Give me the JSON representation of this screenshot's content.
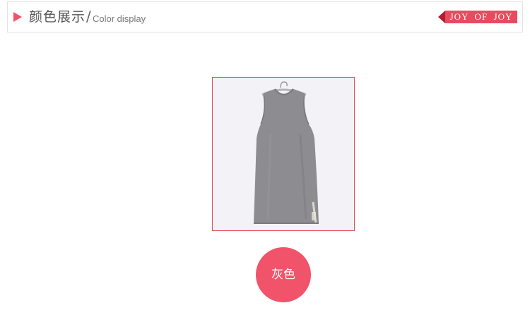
{
  "header": {
    "title_cn": "颜色展示",
    "separator": "/",
    "title_en": "Color display",
    "brand": "JOY  OF  JOY"
  },
  "product": {
    "image_icon": "sleeveless-gray-dress-image"
  },
  "swatch": {
    "label": "灰色"
  },
  "colors": {
    "accent": "#f0536a",
    "brand_dark": "#b01e30",
    "frame_border": "#e2525f",
    "dress_gray": "#8d8d91",
    "image_background": "#f3f2f7"
  }
}
